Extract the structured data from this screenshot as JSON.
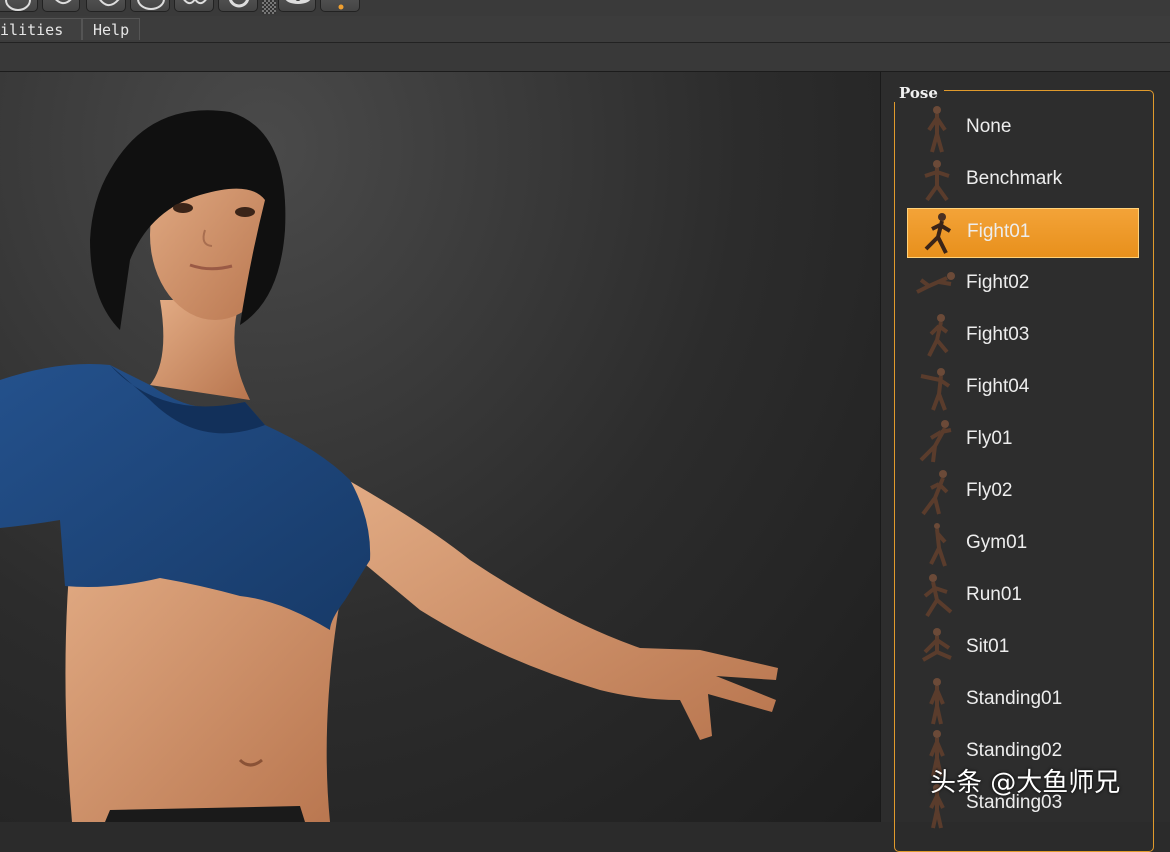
{
  "menu": {
    "utilities": "tilities",
    "help": "Help"
  },
  "toolbar": {
    "icons": [
      "sphere-icon",
      "brush-icon",
      "shape-icon",
      "mesh-icon",
      "wings-icon",
      "ring-icon",
      "checker-icon",
      "eye-icon",
      "dot-icon"
    ]
  },
  "panel": {
    "title": "Pose",
    "selected": "Fight01",
    "items": [
      {
        "label": "None"
      },
      {
        "label": "Benchmark"
      },
      {
        "label": "Fight01"
      },
      {
        "label": "Fight02"
      },
      {
        "label": "Fight03"
      },
      {
        "label": "Fight04"
      },
      {
        "label": "Fly01"
      },
      {
        "label": "Fly02"
      },
      {
        "label": "Gym01"
      },
      {
        "label": "Run01"
      },
      {
        "label": "Sit01"
      },
      {
        "label": "Standing01"
      },
      {
        "label": "Standing02"
      },
      {
        "label": "Standing03"
      }
    ]
  },
  "watermark": "头条 @大鱼师兄",
  "colors": {
    "accent": "#f0a030",
    "shirt": "#1e4478",
    "skin": "#d9a07a",
    "hair": "#111111"
  }
}
